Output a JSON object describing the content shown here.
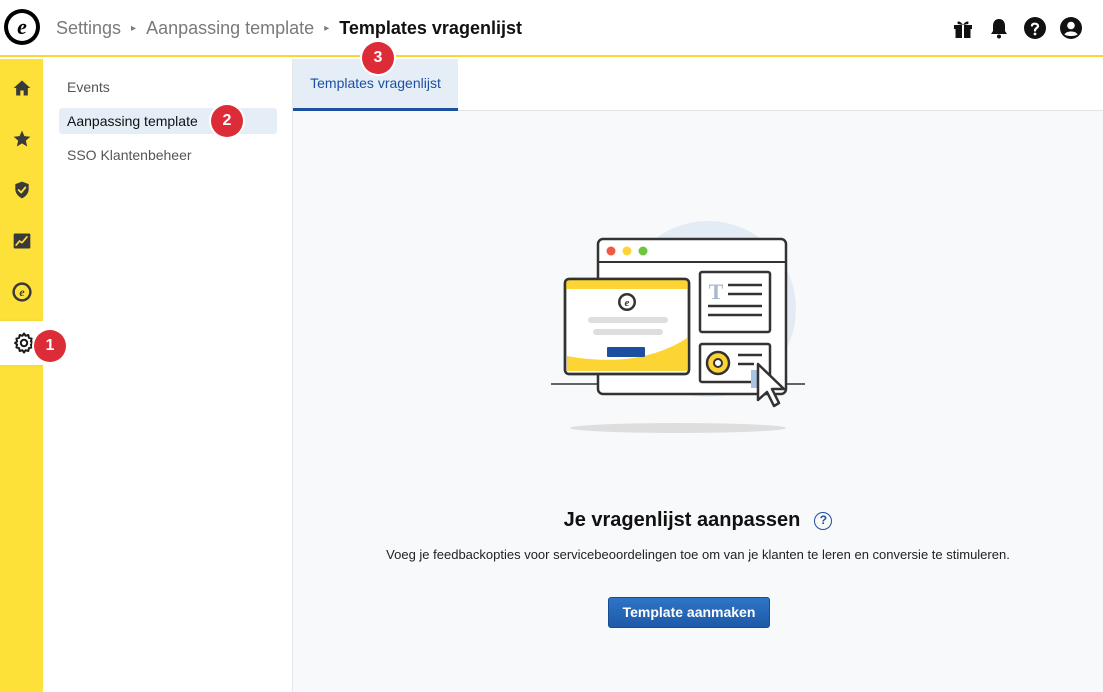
{
  "header": {
    "breadcrumb": [
      "Settings",
      "Aanpassing template"
    ],
    "current": "Templates vragenlijst",
    "logo_letter": "e",
    "icons": [
      "gift-icon",
      "bell-icon",
      "help-icon",
      "account-icon"
    ]
  },
  "rail": {
    "icons": [
      "home-icon",
      "star-icon",
      "shield-check-icon",
      "chart-icon",
      "trusted-e-icon",
      "gear-icon"
    ],
    "active": "gear-icon"
  },
  "subnav": {
    "items": [
      "Events",
      "Aanpassing template",
      "SSO Klantenbeheer"
    ],
    "active_index": 1
  },
  "badges": [
    "1",
    "2",
    "3"
  ],
  "tabs": [
    "Templates vragenlijst"
  ],
  "main": {
    "illustration_logo": "e",
    "illustration_letter": "T",
    "headline": "Je vragenlijst aanpassen",
    "help": "?",
    "description": "Voeg je feedbackopties voor servicebeoordelingen toe om van je klanten te leren en conversie te stimuleren.",
    "button": "Template aanmaken"
  },
  "colors": {
    "rail": "#fde038",
    "accent": "#1c4fa0",
    "badge": "#dc2c38",
    "button": "#1d5aa8"
  }
}
